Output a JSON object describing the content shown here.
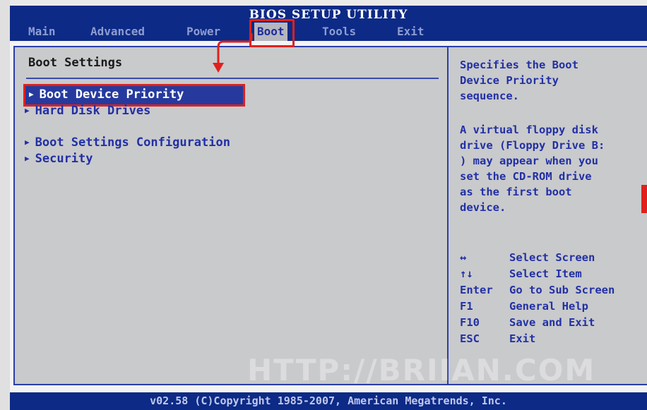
{
  "title": "BIOS SETUP UTILITY",
  "menu": [
    {
      "label": "Main"
    },
    {
      "label": "Advanced"
    },
    {
      "label": "Power"
    },
    {
      "label": "Boot"
    },
    {
      "label": "Tools"
    },
    {
      "label": "Exit"
    }
  ],
  "section_title": "Boot Settings",
  "options": [
    {
      "label": "Boot Device Priority"
    },
    {
      "label": "Hard Disk Drives"
    },
    {
      "label": "Boot Settings Configuration"
    },
    {
      "label": "Security"
    }
  ],
  "help": {
    "description": "Specifies the Boot\nDevice Priority\nsequence.",
    "note": "A virtual floppy disk\ndrive (Floppy Drive B:\n) may appear when you\nset the CD-ROM drive\nas the first boot\ndevice.",
    "keys": [
      {
        "key": "↔",
        "action": "Select Screen"
      },
      {
        "key": "↑↓",
        "action": "Select Item"
      },
      {
        "key": "Enter",
        "action": "Go to Sub Screen"
      },
      {
        "key": "F1",
        "action": "General Help"
      },
      {
        "key": "F10",
        "action": "Save and Exit"
      },
      {
        "key": "ESC",
        "action": "Exit"
      }
    ]
  },
  "footer": "v02.58 (C)Copyright 1985-2007, American Megatrends, Inc.",
  "watermark": "HTTP://BRIIAN.COM",
  "colors": {
    "bar_blue": "#0c2a86",
    "panel_gray": "#c9cacc",
    "text_blue": "#2230a4",
    "annotation_red": "#e0201c"
  }
}
